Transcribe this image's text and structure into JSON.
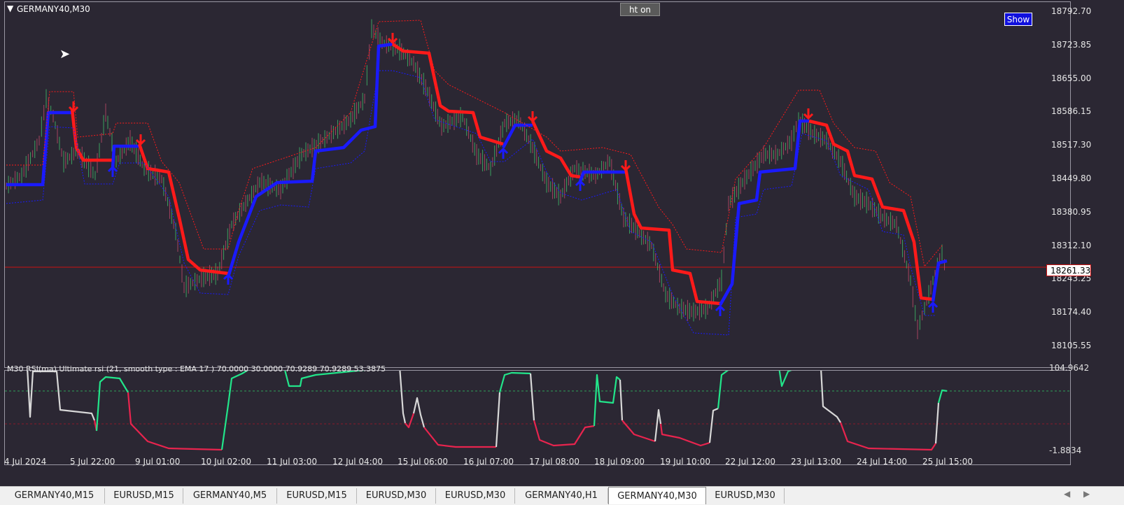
{
  "chart": {
    "symbol_title": "GERMANY40,M30",
    "ht_button": "ht on",
    "show_button": "Show",
    "current_price": "18261.33",
    "price_axis": [
      "18792.70",
      "18723.85",
      "18655.00",
      "18586.15",
      "18517.30",
      "18449.80",
      "18380.95",
      "18312.10",
      "18243.25",
      "18174.40",
      "18105.55"
    ],
    "time_axis": [
      "4 Jul 2024",
      "5 Jul 22:00",
      "9 Jul 01:00",
      "10 Jul 02:00",
      "11 Jul 03:00",
      "12 Jul 04:00",
      "15 Jul 06:00",
      "16 Jul 07:00",
      "17 Jul 08:00",
      "18 Jul 09:00",
      "19 Jul 10:00",
      "22 Jul 12:00",
      "23 Jul 13:00",
      "24 Jul 14:00",
      "25 Jul 15:00"
    ]
  },
  "indicator": {
    "label": "M30 RSI(ma) Ultimate rsi (21, smooth type : EMA  17 ) 70.0000 30.0000 70.9289 70.9289 53.3875",
    "axis_top": "104.9642",
    "axis_bottom": "-1.8834"
  },
  "colors": {
    "background": "#2b2733",
    "bull": "#1a1aff",
    "bear": "#ff1a1a",
    "rsi_up": "#22e58a",
    "rsi_down": "#e8244e",
    "rsi_neutral": "#d8d8d8",
    "price_line": "#cc1111"
  },
  "tabs": [
    {
      "label": "GERMANY40,M15",
      "active": false
    },
    {
      "label": "EURUSD,M15",
      "active": false
    },
    {
      "label": "GERMANY40,M5",
      "active": false
    },
    {
      "label": "EURUSD,M15",
      "active": false
    },
    {
      "label": "EURUSD,M30",
      "active": false
    },
    {
      "label": "EURUSD,M30",
      "active": false
    },
    {
      "label": "GERMANY40,H1",
      "active": false
    },
    {
      "label": "GERMANY40,M30",
      "active": true
    },
    {
      "label": "EURUSD,M30",
      "active": false
    }
  ]
}
